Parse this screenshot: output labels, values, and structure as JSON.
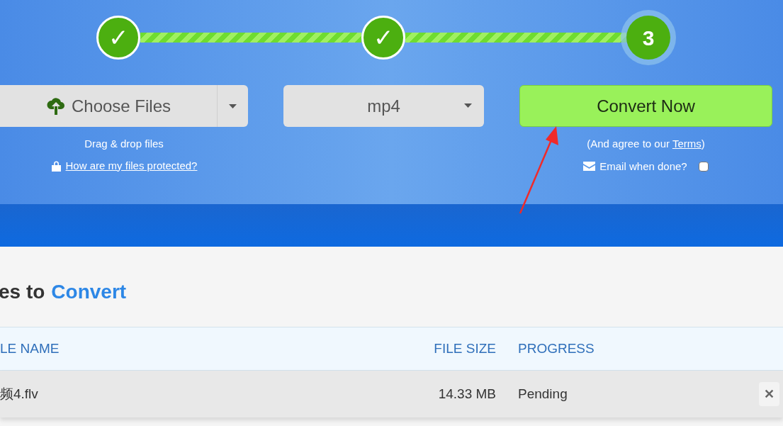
{
  "steps": [
    {
      "label": "✓",
      "done": true,
      "current": false
    },
    {
      "label": "✓",
      "done": true,
      "current": false
    },
    {
      "label": "3",
      "done": false,
      "current": true
    }
  ],
  "upload": {
    "button": "Choose Files",
    "hint": "Drag & drop files",
    "link": "How are my files protected?"
  },
  "format": {
    "value": "mp4"
  },
  "convert": {
    "button": "Convert Now",
    "agree_prefix": "(And agree to our ",
    "agree_link": "Terms",
    "agree_suffix": ")",
    "email_label": "Email when done?",
    "email_checked": false
  },
  "files_heading": {
    "prefix": "es to",
    "highlight": "Convert"
  },
  "table": {
    "columns": [
      "LE NAME",
      "FILE SIZE",
      "PROGRESS"
    ],
    "rows": [
      {
        "name": "频4.flv",
        "size": "14.33 MB",
        "progress": "Pending",
        "remove": "✕"
      }
    ]
  }
}
